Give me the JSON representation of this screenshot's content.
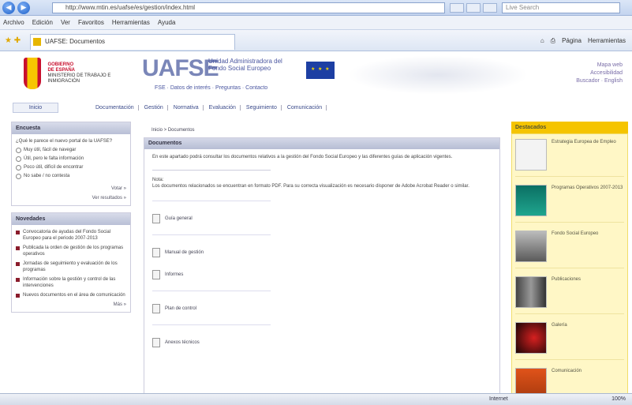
{
  "browser": {
    "url": "http://www.mtin.es/uafse/es/gestion/index.html",
    "search_placeholder": "Live Search",
    "menu": [
      "Archivo",
      "Edición",
      "Ver",
      "Favoritos",
      "Herramientas",
      "Ayuda"
    ],
    "tab_title": "UAFSE: Documentos",
    "commands": [
      "Página",
      "Herramientas"
    ],
    "status_zone": "Internet",
    "status_zoom": "100%"
  },
  "header": {
    "gov_line1": "GOBIERNO",
    "gov_line2": "DE ESPAÑA",
    "gov_ministry": "MINISTERIO DE TRABAJO E INMIGRACIÓN",
    "brand": "UAFSE",
    "brand_sub": "Unidad Administradora del Fondo Social Europeo",
    "sub_links": "FSE · Datos de interés · Preguntas · Contacto",
    "top_links": [
      "Mapa web",
      "Accesibilidad",
      "Buscador · English"
    ]
  },
  "topnav": {
    "home": "Inicio",
    "items": [
      "Documentación",
      "Gestión",
      "Normativa",
      "Evaluación",
      "Seguimiento",
      "Comunicación"
    ]
  },
  "sidebar": {
    "poll_title": "Encuesta",
    "poll_question": "¿Qué le parece el nuevo portal de la UAFSE?",
    "poll_options": [
      "Muy útil, fácil de navegar",
      "Útil, pero le falta información",
      "Poco útil, difícil de encontrar",
      "No sabe / no contesta"
    ],
    "poll_vote": "Votar »",
    "poll_results": "Ver resultados »",
    "news_title": "Novedades",
    "news": [
      "Convocatoria de ayudas del Fondo Social Europeo para el periodo 2007-2013",
      "Publicada la orden de gestión de los programas operativos",
      "Jornadas de seguimiento y evaluación de los programas",
      "Información sobre la gestión y control de las intervenciones",
      "Nuevos documentos en el área de comunicación"
    ],
    "news_more": "Más »"
  },
  "main": {
    "breadcrumb": "Inicio > Documentos",
    "title": "Documentos",
    "intro": "En este apartado podrá consultar los documentos relativos a la gestión del Fondo Social Europeo y las diferentes guías de aplicación vigentes.",
    "note_title": "Nota:",
    "note_text": "Los documentos relacionados se encuentran en formato PDF. Para su correcta visualización es necesario disponer de Adobe Acrobat Reader o similar.",
    "docs": [
      "Guía general",
      "Manual de gestión",
      "Informes",
      "Plan de control",
      "Anexos técnicos"
    ]
  },
  "rightbar": {
    "title": "Destacados",
    "items": [
      "Estrategia Europea de Empleo",
      "Programas Operativos 2007-2013",
      "Fondo Social Europeo",
      "Publicaciones",
      "Galería",
      "Comunicación"
    ]
  }
}
